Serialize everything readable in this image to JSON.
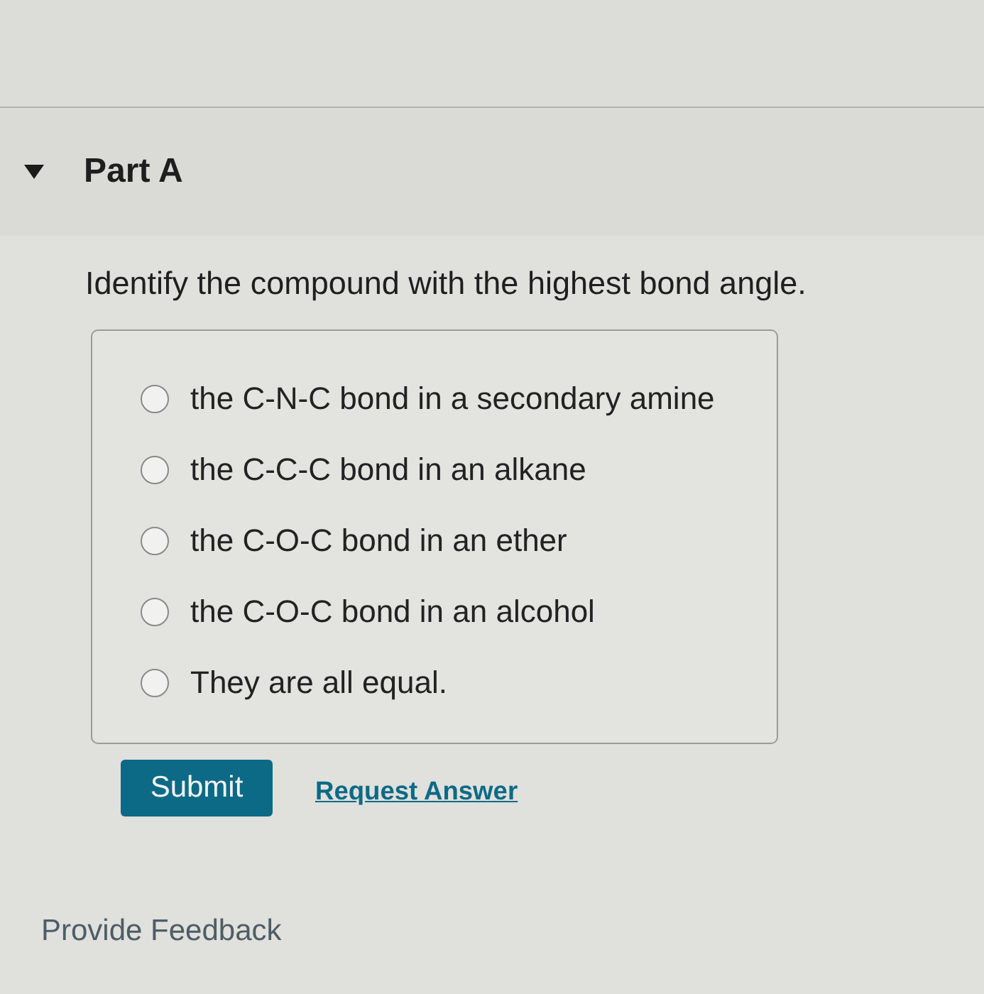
{
  "part": {
    "title": "Part A",
    "expanded": true
  },
  "question": {
    "prompt": "Identify the compound with the highest bond angle.",
    "options": [
      {
        "label": "the C-N-C bond in a secondary amine",
        "selected": false
      },
      {
        "label": "the C-C-C bond in an alkane",
        "selected": false
      },
      {
        "label": "the C-O-C bond in an ether",
        "selected": false
      },
      {
        "label": "the C-O-C bond in an alcohol",
        "selected": false
      },
      {
        "label": "They are all equal.",
        "selected": false
      }
    ]
  },
  "actions": {
    "submit": "Submit",
    "request_answer": "Request Answer"
  },
  "feedback_link": "Provide Feedback"
}
